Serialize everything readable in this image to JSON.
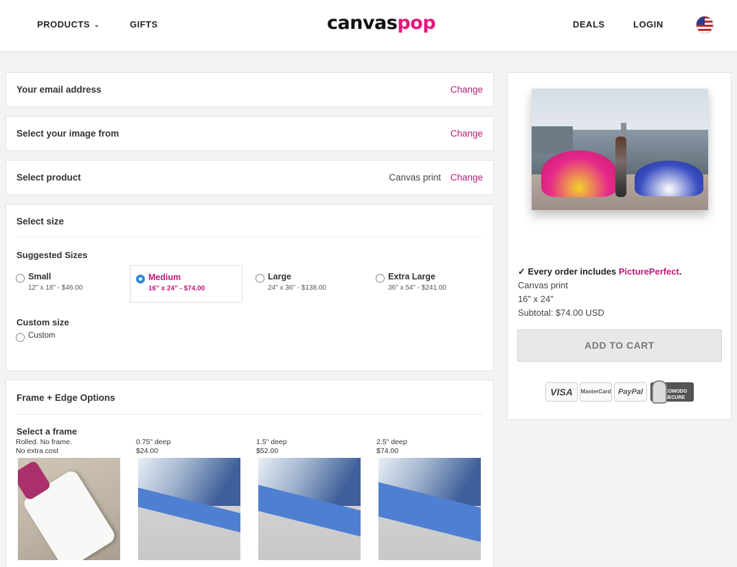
{
  "header": {
    "products": "PRODUCTS",
    "gifts": "GIFTS",
    "logo_part1": "canvas",
    "logo_part2": "pop",
    "deals": "DEALS",
    "login": "LOGIN",
    "flag_icon": "us-flag-icon"
  },
  "steps": {
    "email": {
      "label": "Your email address",
      "change": "Change"
    },
    "image": {
      "label": "Select your image from",
      "change": "Change"
    },
    "product": {
      "label": "Select product",
      "value": "Canvas print",
      "change": "Change"
    }
  },
  "size": {
    "title": "Select size",
    "suggested_title": "Suggested Sizes",
    "options": [
      {
        "name": "Small",
        "price": "12\" x 18\" - $46.00"
      },
      {
        "name": "Medium",
        "price": "16\" x 24\" - $74.00"
      },
      {
        "name": "Large",
        "price": "24\" x 36\" - $138.00"
      },
      {
        "name": "Extra Large",
        "price": "36\" x 54\" - $241.00"
      }
    ],
    "selected": "Medium",
    "custom_title": "Custom size",
    "custom_label": "Custom"
  },
  "frame": {
    "title": "Frame + Edge Options",
    "select_title": "Select a frame",
    "options": [
      {
        "line1": "Rolled. No frame.",
        "line2": "No extra cost"
      },
      {
        "line1": "0.75\" deep",
        "line2": "$24.00"
      },
      {
        "line1": "1.5\" deep",
        "line2": "$52.00"
      },
      {
        "line1": "2.5\" deep",
        "line2": "$74.00"
      }
    ]
  },
  "summary": {
    "includes_prefix": "✓ Every order includes ",
    "includes_brand": "PicturePerfect",
    "includes_suffix": ".",
    "product": "Canvas print",
    "size": "16\" x 24\"",
    "subtotal": "Subtotal: $74.00 USD",
    "add_to_cart": "ADD TO CART",
    "payments": [
      "VISA",
      "MasterCard",
      "PayPal",
      "COMODO SECURE"
    ]
  },
  "colors": {
    "accent": "#c2187a",
    "logo_pink": "#e4177d",
    "radio_selected": "#2e8bd9"
  }
}
